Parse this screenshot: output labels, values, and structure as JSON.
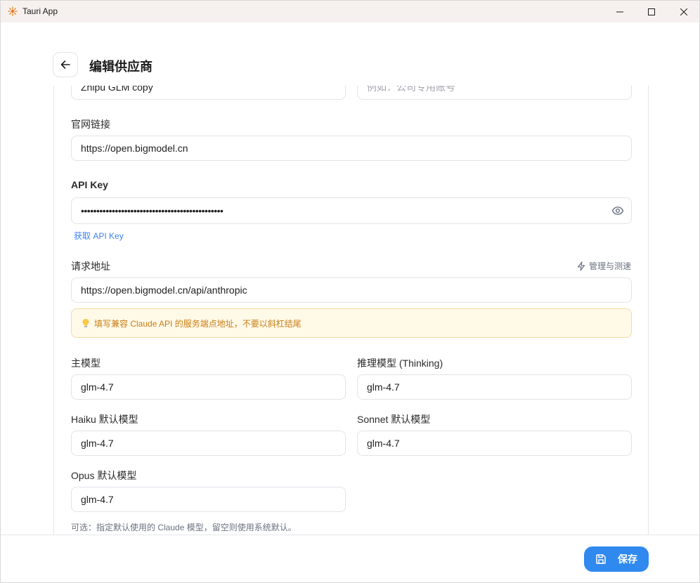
{
  "window": {
    "title": "Tauri App"
  },
  "header": {
    "title": "编辑供应商"
  },
  "form": {
    "name_value": "Zhipu GLM copy",
    "note_placeholder": "例如：公司专用账号",
    "website": {
      "label": "官网链接",
      "value": "https://open.bigmodel.cn"
    },
    "api_key": {
      "label": "API Key",
      "value": "••••••••••••••••••••••••••••••••••••••••••••••",
      "get_link": "获取 API Key"
    },
    "endpoint": {
      "label": "请求地址",
      "manage_link": "管理与测速",
      "value": "https://open.bigmodel.cn/api/anthropic",
      "hint": "填写兼容 Claude API 的服务端点地址，不要以斜杠结尾"
    },
    "models": {
      "main": {
        "label": "主模型",
        "value": "glm-4.7"
      },
      "thinking": {
        "label": "推理模型 (Thinking)",
        "value": "glm-4.7"
      },
      "haiku": {
        "label": "Haiku 默认模型",
        "value": "glm-4.7"
      },
      "sonnet": {
        "label": "Sonnet 默认模型",
        "value": "glm-4.7"
      },
      "opus": {
        "label": "Opus 默认模型",
        "value": "glm-4.7"
      },
      "note": "可选：指定默认使用的 Claude 模型，留空则使用系统默认。"
    }
  },
  "footer": {
    "save_label": "保存"
  },
  "colors": {
    "accent": "#2f89ee",
    "link": "#3b82f6",
    "hint_text": "#c97e16",
    "hint_bg": "#fff9e8"
  }
}
